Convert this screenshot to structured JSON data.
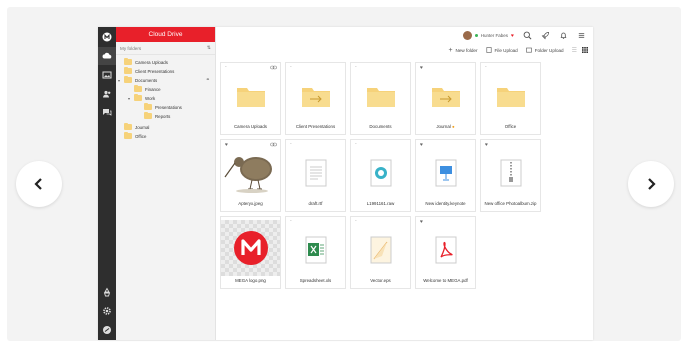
{
  "sidebar_header": "Cloud Drive",
  "tree": {
    "title": "My folders",
    "items": [
      {
        "label": "Camera Uploads"
      },
      {
        "label": "Client Presentations"
      },
      {
        "label": "Documents"
      },
      {
        "label": "Finance"
      },
      {
        "label": "Work"
      },
      {
        "label": "Presentations"
      },
      {
        "label": "Reports"
      },
      {
        "label": "Journal"
      },
      {
        "label": "Office"
      }
    ]
  },
  "user": {
    "name": "Hunter Fabes"
  },
  "actions": {
    "new_folder": "New folder",
    "file_upload": "File Upload",
    "folder_upload": "Folder Upload"
  },
  "files": [
    {
      "name": "Camera Uploads"
    },
    {
      "name": "Client Presentations"
    },
    {
      "name": "Documents"
    },
    {
      "name": "Journal"
    },
    {
      "name": "Office"
    },
    {
      "name": "Apteryx.jpeg"
    },
    {
      "name": "draft.rtf"
    },
    {
      "name": "L1991161.raw"
    },
    {
      "name": "New identity.keynote"
    },
    {
      "name": "New office Photoalbum.zip"
    },
    {
      "name": "MEGA logo.png"
    },
    {
      "name": "Spreadsheet.xls"
    },
    {
      "name": "Vector.eps"
    },
    {
      "name": "Welcome to MEGA.pdf"
    }
  ],
  "colors": {
    "accent": "#e8202a",
    "folder": "#f6d27a",
    "rail": "#2e2e2e"
  }
}
